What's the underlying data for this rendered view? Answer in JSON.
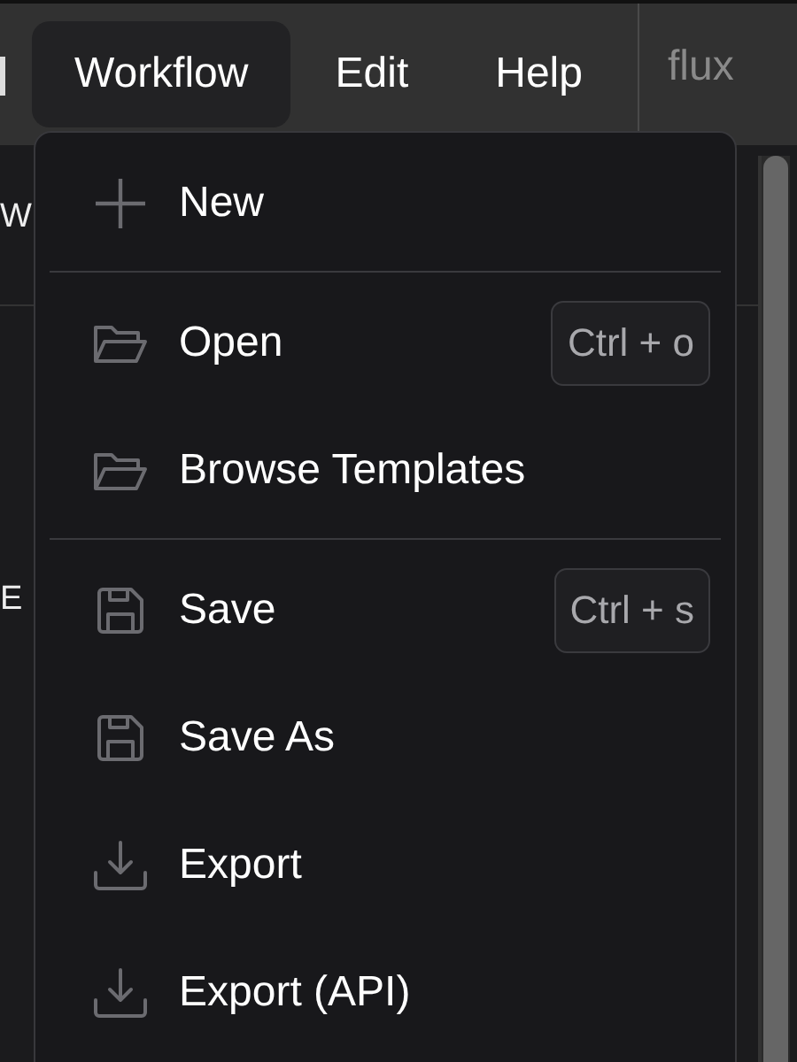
{
  "menubar": {
    "items": [
      {
        "label": "Workflow",
        "selected": true
      },
      {
        "label": "Edit",
        "selected": false
      },
      {
        "label": "Help",
        "selected": false
      }
    ],
    "workflow_name": "flux"
  },
  "background_texts": [
    "W",
    "E"
  ],
  "menu": {
    "items": [
      {
        "kind": "create",
        "label": "New"
      },
      {
        "kind": "divider"
      },
      {
        "kind": "open",
        "label": "Open",
        "shortcut": "Ctrl + o"
      },
      {
        "kind": "open",
        "label": "Browse Templates"
      },
      {
        "kind": "divider"
      },
      {
        "kind": "save",
        "label": "Save",
        "shortcut": "Ctrl + s"
      },
      {
        "kind": "save",
        "label": "Save As"
      },
      {
        "kind": "export",
        "label": "Export"
      },
      {
        "kind": "export",
        "label": "Export (API)"
      }
    ]
  }
}
